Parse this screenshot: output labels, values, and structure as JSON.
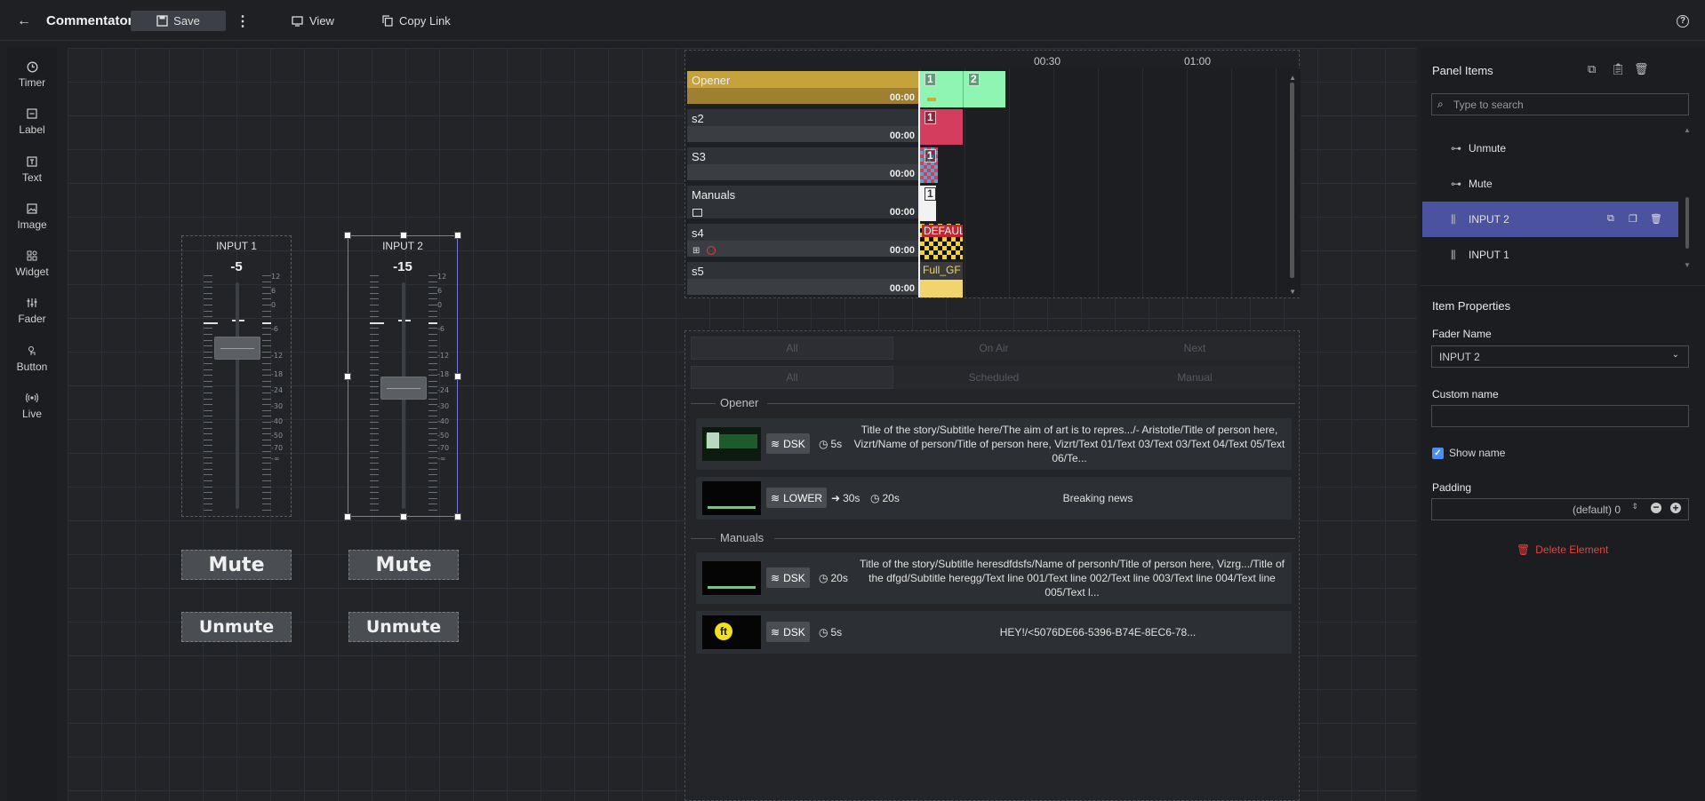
{
  "app": {
    "title": "Commentator",
    "save_label": "Save",
    "view_label": "View",
    "copy_link_label": "Copy Link"
  },
  "tools": [
    {
      "label": "Timer",
      "icon": "clock-icon"
    },
    {
      "label": "Label",
      "icon": "label-icon"
    },
    {
      "label": "Text",
      "icon": "text-icon"
    },
    {
      "label": "Image",
      "icon": "image-icon"
    },
    {
      "label": "Widget",
      "icon": "widget-icon"
    },
    {
      "label": "Fader",
      "icon": "fader-icon"
    },
    {
      "label": "Button",
      "icon": "button-icon"
    },
    {
      "label": "Live",
      "icon": "live-icon"
    }
  ],
  "faders": [
    {
      "name": "INPUT 1",
      "value": "-5",
      "level_db": -5,
      "selected": false
    },
    {
      "name": "INPUT 2",
      "value": "-15",
      "level_db": -15,
      "selected": true
    }
  ],
  "scale_labels": [
    "12",
    "6",
    "0",
    "-6",
    "-12",
    "-18",
    "-24",
    "-30",
    "-40",
    "-50",
    "-70",
    "-∞"
  ],
  "buttons": {
    "mute": "Mute",
    "unmute": "Unmute"
  },
  "timeline": {
    "times": [
      "00:30",
      "01:00"
    ],
    "rows": [
      {
        "name": "Opener",
        "time": "00:00",
        "color": "#c6a23c"
      },
      {
        "name": "s2",
        "time": "00:00",
        "color": "#2f3236"
      },
      {
        "name": "S3",
        "time": "00:00",
        "color": "#2f3236"
      },
      {
        "name": "Manuals",
        "time": "00:00",
        "color": "#2f3236"
      },
      {
        "name": "s4",
        "time": "00:00",
        "color": "#2f3236"
      },
      {
        "name": "s5",
        "time": "00:00",
        "color": "#2f3236"
      }
    ],
    "blocks": {
      "opener_1": "1",
      "opener_2": "2",
      "s2_1": "1",
      "s3_1": "1",
      "manuals_1": "1",
      "s4_label": "DEFAULT",
      "s5_label": "Full_GF"
    }
  },
  "playlist": {
    "tabs1": [
      "All",
      "On Air",
      "Next"
    ],
    "tabs2": [
      "All",
      "Scheduled",
      "Manual"
    ],
    "sections": [
      {
        "name": "Opener",
        "items": [
          {
            "tag": "DSK",
            "duration": "5s",
            "text": "Title of the story/Subtitle here/The aim of art is to repres.../- Aristotle/Title of person here, Vizrt/Name of person/Title of person here, Vizrt/Text 01/Text 03/Text 03/Text 04/Text 05/Text 06/Te..."
          },
          {
            "tag": "LOWER",
            "arrow_duration": "30s",
            "duration": "20s",
            "text": "Breaking news"
          }
        ]
      },
      {
        "name": "Manuals",
        "items": [
          {
            "tag": "DSK",
            "duration": "20s",
            "text": "Title of the story/Subtitle heresdfdsfs/Name of personh/Title of person here, Vizrg.../Title of the dfgd/Subtitle heregg/Text line 001/Text line 002/Text line 003/Text line 004/Text line 005/Text l..."
          },
          {
            "tag": "DSK",
            "duration": "5s",
            "text": "HEY!/<5076DE66-5396-B74E-8EC6-78..."
          }
        ]
      }
    ]
  },
  "panel_items": {
    "title": "Panel Items",
    "search_placeholder": "Type to search",
    "items": [
      {
        "label": "Unmute",
        "icon": "button-icon"
      },
      {
        "label": "Mute",
        "icon": "button-icon"
      },
      {
        "label": "INPUT 2",
        "icon": "fader-icon",
        "selected": true
      },
      {
        "label": "INPUT 1",
        "icon": "fader-icon"
      }
    ]
  },
  "item_properties": {
    "title": "Item Properties",
    "fader_name_label": "Fader Name",
    "fader_name_value": "INPUT 2",
    "custom_name_label": "Custom name",
    "custom_name_value": "",
    "show_name_label": "Show name",
    "show_name_checked": true,
    "padding_label": "Padding",
    "padding_value": "(default) 0",
    "delete_label": "Delete Element"
  },
  "colors": {
    "accent": "#4b52a0",
    "danger": "#e0463f",
    "opener": "#c6a23c",
    "green_block": "#8ef5b2",
    "red_block": "#d43d5e"
  }
}
